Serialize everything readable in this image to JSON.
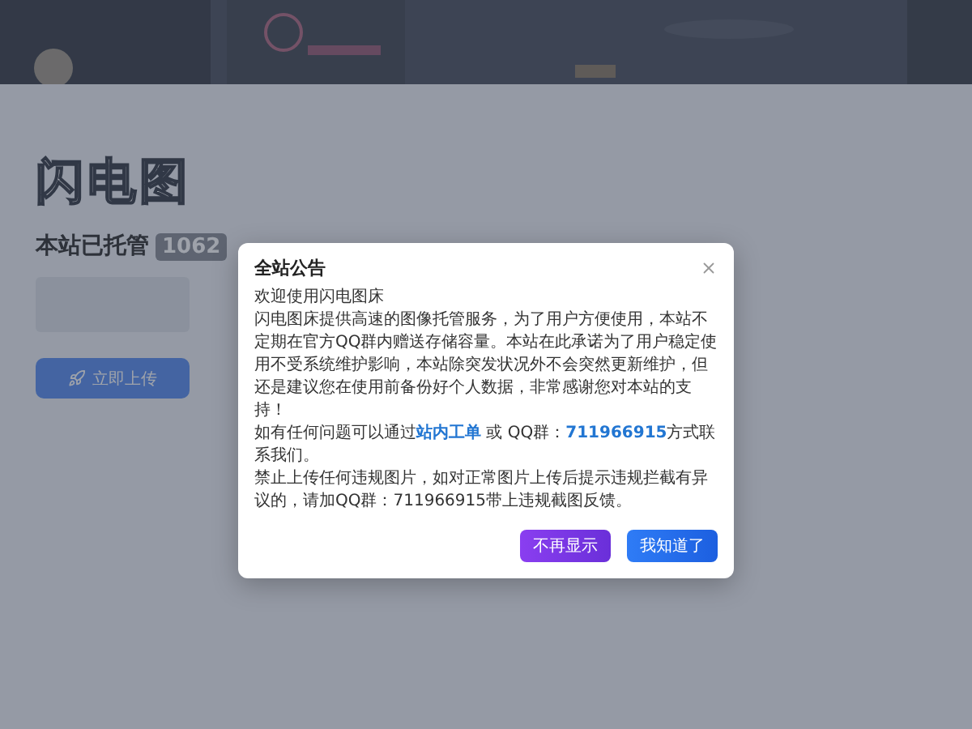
{
  "hero": {
    "title": "闪电图",
    "hosted_label": "本站已托管",
    "hosted_count": "1062",
    "upload_button": "立即上传"
  },
  "modal": {
    "title": "全站公告",
    "paragraphs": [
      [
        {
          "kind": "text",
          "text": "欢迎使用闪电图床"
        }
      ],
      [
        {
          "kind": "text",
          "text": "闪电图床提供高速的图像托管服务，为了用户方便使用，本站不定期在官方QQ群内赠送存储容量。本站在此承诺为了用户稳定使用不受系统维护影响，本站除突发状况外不会突然更新维护，但还是建议您在使用前备份好个人数据，非常感谢您对本站的支持！"
        }
      ],
      [
        {
          "kind": "text",
          "text": "如有任何问题可以通过"
        },
        {
          "kind": "link",
          "text": "站内工单"
        },
        {
          "kind": "text",
          "text": " 或 QQ群："
        },
        {
          "kind": "link",
          "text": "711966915"
        },
        {
          "kind": "text",
          "text": "方式联系我们。"
        }
      ],
      [
        {
          "kind": "text",
          "text": "禁止上传任何违规图片，如对正常图片上传后提示违规拦截有异议的，请加QQ群：711966915带上违规截图反馈。"
        }
      ]
    ],
    "buttons": [
      {
        "kind": "secondary",
        "label": "不再显示"
      },
      {
        "kind": "primary",
        "label": "我知道了"
      }
    ]
  }
}
